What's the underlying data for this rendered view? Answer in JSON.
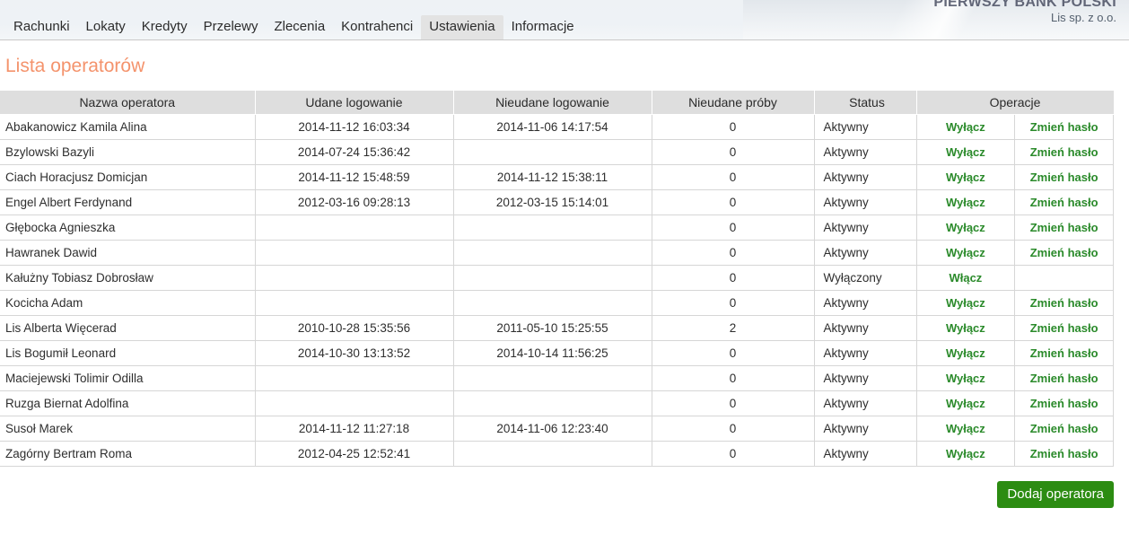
{
  "header": {
    "bank_name": "PIERWSZY BANK POLSKI",
    "company": "Lis sp. z o.o.",
    "nav": [
      {
        "label": "Rachunki",
        "active": false
      },
      {
        "label": "Lokaty",
        "active": false
      },
      {
        "label": "Kredyty",
        "active": false
      },
      {
        "label": "Przelewy",
        "active": false
      },
      {
        "label": "Zlecenia",
        "active": false
      },
      {
        "label": "Kontrahenci",
        "active": false
      },
      {
        "label": "Ustawienia",
        "active": true
      },
      {
        "label": "Informacje",
        "active": false
      }
    ]
  },
  "page": {
    "title": "Lista operatorów",
    "title_color": "#f4936c"
  },
  "table": {
    "columns": [
      "Nazwa operatora",
      "Udane logowanie",
      "Nieudane logowanie",
      "Nieudane próby",
      "Status",
      "Operacje"
    ],
    "rows": [
      {
        "name": "Abakanowicz Kamila Alina",
        "success": "2014-11-12 16:03:34",
        "failure": "2014-11-06 14:17:54",
        "attempts": "0",
        "status": "Aktywny",
        "op1": "Wyłącz",
        "op2": "Zmień hasło"
      },
      {
        "name": "Bzylowski Bazyli",
        "success": "2014-07-24 15:36:42",
        "failure": "",
        "attempts": "0",
        "status": "Aktywny",
        "op1": "Wyłącz",
        "op2": "Zmień hasło"
      },
      {
        "name": "Ciach Horacjusz Domicjan",
        "success": "2014-11-12 15:48:59",
        "failure": "2014-11-12 15:38:11",
        "attempts": "0",
        "status": "Aktywny",
        "op1": "Wyłącz",
        "op2": "Zmień hasło"
      },
      {
        "name": "Engel Albert Ferdynand",
        "success": "2012-03-16 09:28:13",
        "failure": "2012-03-15 15:14:01",
        "attempts": "0",
        "status": "Aktywny",
        "op1": "Wyłącz",
        "op2": "Zmień hasło"
      },
      {
        "name": "Głębocka Agnieszka",
        "success": "",
        "failure": "",
        "attempts": "0",
        "status": "Aktywny",
        "op1": "Wyłącz",
        "op2": "Zmień hasło"
      },
      {
        "name": "Hawranek Dawid",
        "success": "",
        "failure": "",
        "attempts": "0",
        "status": "Aktywny",
        "op1": "Wyłącz",
        "op2": "Zmień hasło"
      },
      {
        "name": "Kałużny Tobiasz Dobrosław",
        "success": "",
        "failure": "",
        "attempts": "0",
        "status": "Wyłączony",
        "op1": "Włącz",
        "op2": ""
      },
      {
        "name": "Kocicha Adam",
        "success": "",
        "failure": "",
        "attempts": "0",
        "status": "Aktywny",
        "op1": "Wyłącz",
        "op2": "Zmień hasło"
      },
      {
        "name": "Lis Alberta Więcerad",
        "success": "2010-10-28 15:35:56",
        "failure": "2011-05-10 15:25:55",
        "attempts": "2",
        "status": "Aktywny",
        "op1": "Wyłącz",
        "op2": "Zmień hasło"
      },
      {
        "name": "Lis Bogumił Leonard",
        "success": "2014-10-30 13:13:52",
        "failure": "2014-10-14 11:56:25",
        "attempts": "0",
        "status": "Aktywny",
        "op1": "Wyłącz",
        "op2": "Zmień hasło"
      },
      {
        "name": "Maciejewski Tolimir Odilla",
        "success": "",
        "failure": "",
        "attempts": "0",
        "status": "Aktywny",
        "op1": "Wyłącz",
        "op2": "Zmień hasło"
      },
      {
        "name": "Ruzga Biernat Adolfina",
        "success": "",
        "failure": "",
        "attempts": "0",
        "status": "Aktywny",
        "op1": "Wyłącz",
        "op2": "Zmień hasło"
      },
      {
        "name": "Susoł Marek",
        "success": "2014-11-12 11:27:18",
        "failure": "2014-11-06 12:23:40",
        "attempts": "0",
        "status": "Aktywny",
        "op1": "Wyłącz",
        "op2": "Zmień hasło"
      },
      {
        "name": "Zagórny Bertram Roma",
        "success": "2012-04-25 12:52:41",
        "failure": "",
        "attempts": "0",
        "status": "Aktywny",
        "op1": "Wyłącz",
        "op2": "Zmień hasło"
      }
    ]
  },
  "footer": {
    "add_button_label": "Dodaj operatora",
    "add_button_color": "#2c8c12"
  }
}
